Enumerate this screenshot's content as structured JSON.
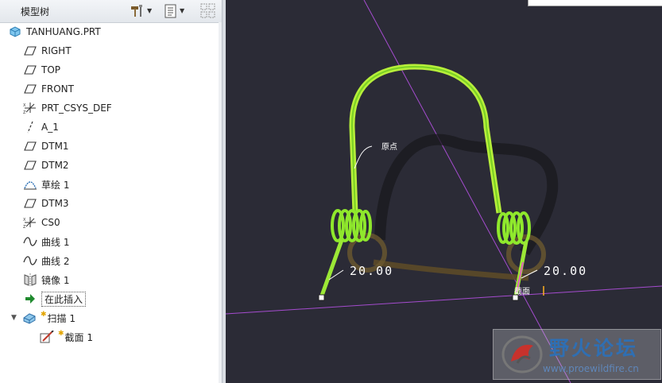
{
  "tree": {
    "title": "模型树",
    "toolbar": {
      "settings_icon": "hammer-settings-icon",
      "show_icon": "list-show-icon",
      "filter_icon": "filter-icon"
    },
    "items": [
      {
        "label": "TANHUANG.PRT",
        "icon": "part-icon"
      },
      {
        "label": "RIGHT",
        "icon": "datum-plane-icon"
      },
      {
        "label": "TOP",
        "icon": "datum-plane-icon"
      },
      {
        "label": "FRONT",
        "icon": "datum-plane-icon"
      },
      {
        "label": "PRT_CSYS_DEF",
        "icon": "coordinate-system-icon"
      },
      {
        "label": "A_1",
        "icon": "datum-axis-icon"
      },
      {
        "label": "DTM1",
        "icon": "datum-plane-icon"
      },
      {
        "label": "DTM2",
        "icon": "datum-plane-icon"
      },
      {
        "label": "草绘 1",
        "icon": "sketch-icon"
      },
      {
        "label": "DTM3",
        "icon": "datum-plane-icon"
      },
      {
        "label": "CS0",
        "icon": "coordinate-system-icon"
      },
      {
        "label": "曲线 1",
        "icon": "curve-icon"
      },
      {
        "label": "曲线 2",
        "icon": "curve-icon"
      },
      {
        "label": "镜像 1",
        "icon": "mirror-icon"
      },
      {
        "label": "在此插入",
        "icon": "insert-here-arrow-icon"
      },
      {
        "label": "扫描 1",
        "icon": "sweep-feature-icon"
      },
      {
        "label": "截面 1",
        "icon": "section-sketch-icon"
      }
    ]
  },
  "viewport": {
    "origin_label": "原点",
    "dim_left": "20.00",
    "dim_right": "20.00",
    "section_label": "截面",
    "colors": {
      "background": "#2b2b36",
      "spring": "#8ee82a",
      "datum_plane": "#a54ccf"
    }
  },
  "watermark": {
    "title": "野火论坛",
    "url": "www.proewildfire.cn"
  }
}
